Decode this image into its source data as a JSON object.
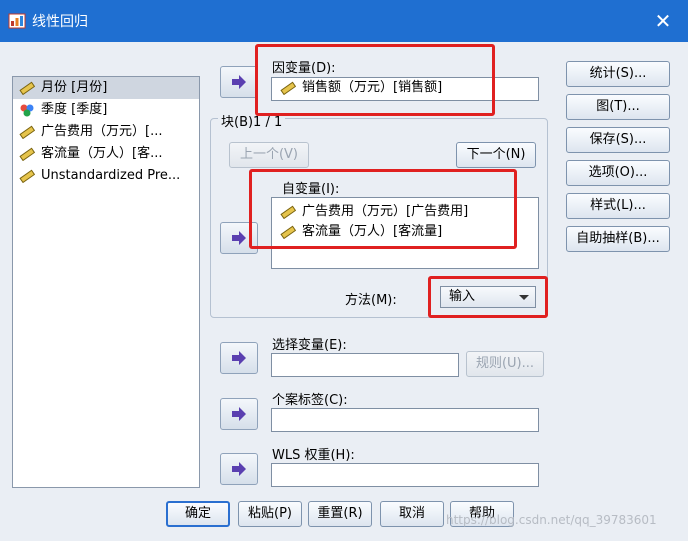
{
  "window": {
    "title": "线性回归",
    "close_glyph": "✕"
  },
  "variables": [
    {
      "label": "月份 [月份]",
      "icon": "ruler-icon",
      "selected": true
    },
    {
      "label": "季度 [季度]",
      "icon": "nominal-icon",
      "selected": false
    },
    {
      "label": "广告费用（万元）[...",
      "icon": "ruler-icon",
      "selected": false
    },
    {
      "label": "客流量（万人）[客...",
      "icon": "ruler-icon",
      "selected": false
    },
    {
      "label": "Unstandardized Pre...",
      "icon": "ruler-icon",
      "selected": false
    }
  ],
  "dependent": {
    "label": "因变量(D):",
    "value": "销售额（万元）[销售额]"
  },
  "block": {
    "label": "块(B)1 / 1",
    "prev_label": "上一个(V)",
    "next_label": "下一个(N)"
  },
  "independent": {
    "label": "自变量(I):",
    "items": [
      "广告费用（万元）[广告费用]",
      "客流量（万人）[客流量]"
    ]
  },
  "method": {
    "label": "方法(M):",
    "value": "输入"
  },
  "selection": {
    "label": "选择变量(E):",
    "rule_label": "规则(U)...",
    "value": ""
  },
  "case_label": {
    "label": "个案标签(C):",
    "value": ""
  },
  "wls": {
    "label": "WLS 权重(H):",
    "value": ""
  },
  "side_buttons": [
    "统计(S)...",
    "图(T)...",
    "保存(S)...",
    "选项(O)...",
    "样式(L)...",
    "自助抽样(B)..."
  ],
  "bottom_buttons": [
    "确定",
    "粘贴(P)",
    "重置(R)",
    "取消",
    "帮助"
  ],
  "watermark": "https://blog.csdn.net/qq_39783601",
  "colors": {
    "titlebar": "#1f6fd1",
    "highlight_box": "#e02020",
    "arrow": "#5a3fb0"
  }
}
